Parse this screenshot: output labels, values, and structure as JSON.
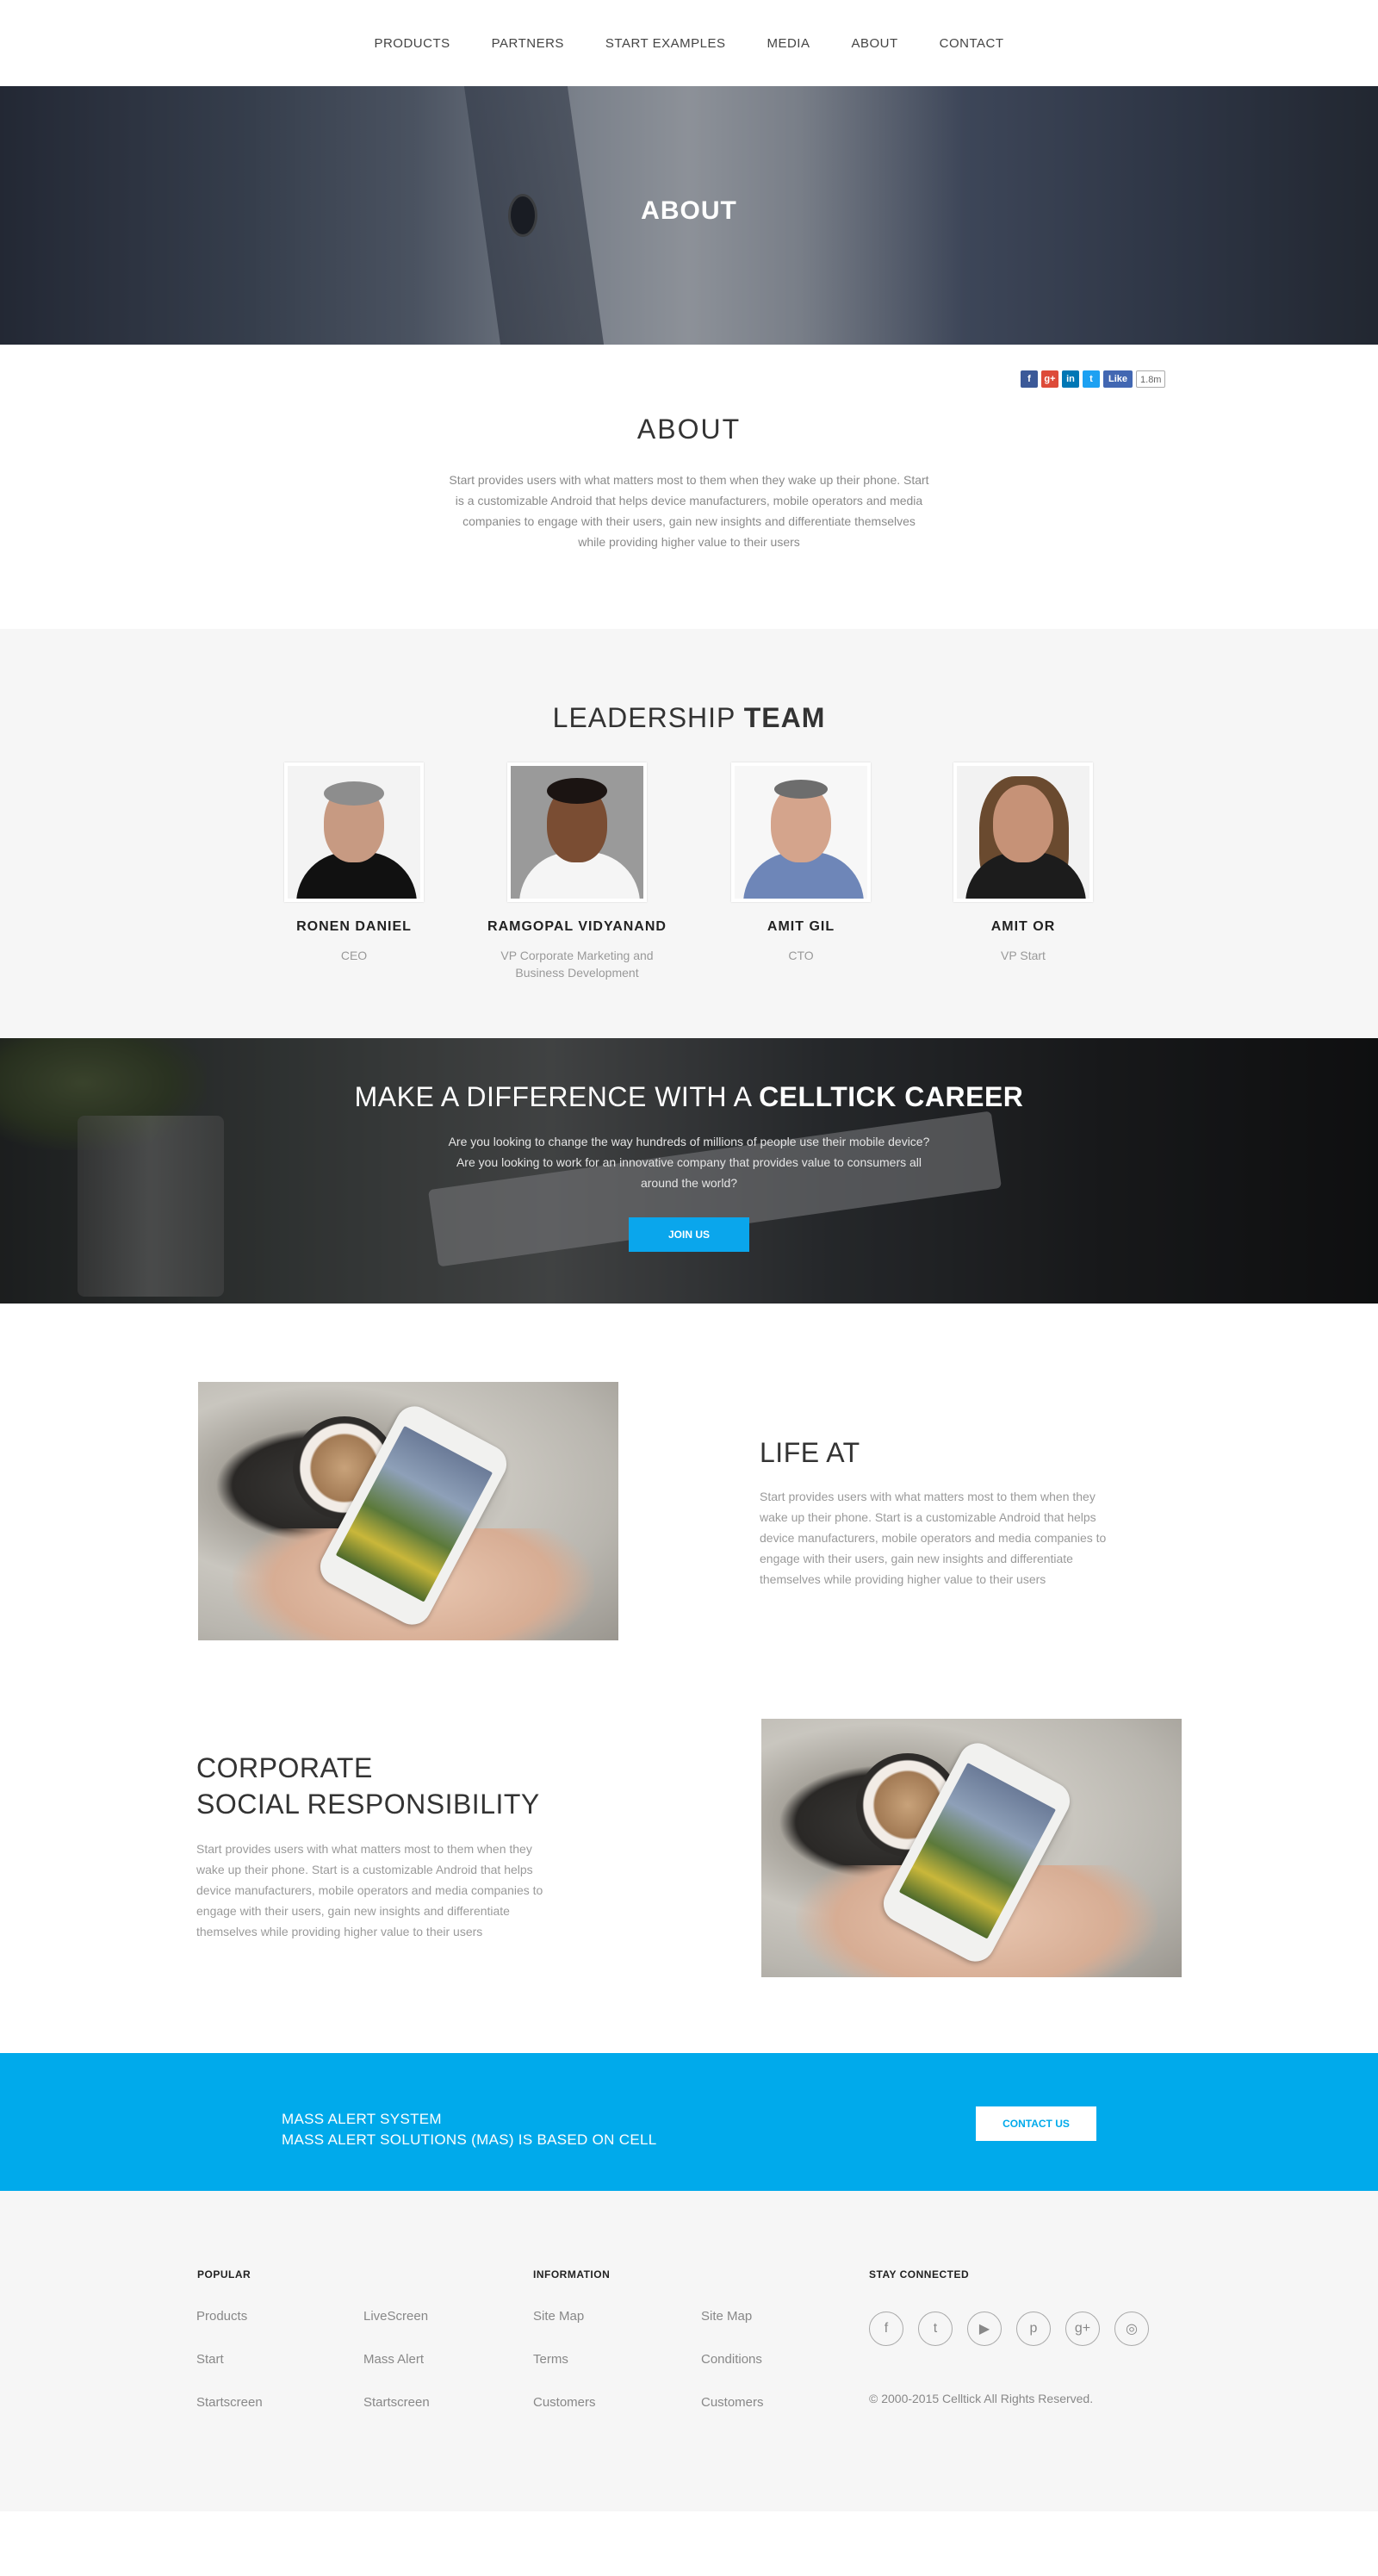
{
  "nav": {
    "items": [
      "PRODUCTS",
      "PARTNERS",
      "START EXAMPLES",
      "MEDIA",
      "ABOUT",
      "CONTACT"
    ]
  },
  "hero": {
    "title": "ABOUT"
  },
  "social": {
    "like_label": "Like",
    "count": "1.8m"
  },
  "about": {
    "title": "ABOUT",
    "text": "Start provides users with what matters most to them when they wake up their phone. Start is a customizable Android  that helps device manufacturers, mobile operators and media companies to engage with their users, gain new insights and differentiate themselves while providing higher value to their users"
  },
  "leadership": {
    "title_light": "LEADERSHIP ",
    "title_bold": "TEAM",
    "members": [
      {
        "name": "RONEN DANIEL",
        "role": "CEO"
      },
      {
        "name": "RAMGOPAL VIDYANAND",
        "role": "VP Corporate Marketing and Business Development"
      },
      {
        "name": "AMIT GIL",
        "role": "CTO"
      },
      {
        "name": "AMIT OR",
        "role": "VP Start"
      }
    ]
  },
  "career": {
    "title_light": "MAKE A DIFFERENCE WITH A ",
    "title_bold": "CELLTICK CAREER",
    "text": "Are you looking to change the way hundreds of millions of people use their mobile device? Are you looking to work for an innovative company that provides value to consumers all around the world?",
    "button": "JOIN US"
  },
  "life": {
    "title": "LIFE AT",
    "text": "Start provides users with what matters most to them when they wake up their phone. Start is a customizable Android  that helps device manufacturers, mobile operators and media companies to engage with their users, gain new insights and differentiate themselves while providing higher value to their users"
  },
  "csr": {
    "title_line1": "CORPORATE",
    "title_line2": "SOCIAL RESPONSIBILITY",
    "text": "Start provides users with what matters most to them when they wake up their phone. Start is a customizable Android  that helps device manufacturers, mobile operators and media companies to engage with their users, gain new insights and differentiate themselves while providing higher value to their users"
  },
  "mas": {
    "line1": "MASS ALERT SYSTEM",
    "line2": "MASS ALERT SOLUTIONS (MAS) IS BASED ON CELL",
    "button": "CONTACT US"
  },
  "footer": {
    "popular_heading": "POPULAR",
    "popular_col1": [
      "Products",
      "Start",
      "Startscreen"
    ],
    "popular_col2": [
      "LiveScreen",
      "Mass Alert",
      "Startscreen"
    ],
    "information_heading": "INFORMATION",
    "info_col1": [
      "Site Map",
      "Terms",
      "Customers"
    ],
    "info_col2": [
      "Site Map",
      "Conditions",
      "Customers"
    ],
    "stay_heading": "STAY CONNECTED",
    "social_icons": [
      "facebook-icon",
      "twitter-icon",
      "youtube-icon",
      "pinterest-icon",
      "google-plus-icon",
      "instagram-icon"
    ],
    "copyright": "© 2000-2015 Celltick All Rights Reserved."
  },
  "colors": {
    "accent": "#00aaeb",
    "button": "#0aa6ec"
  }
}
